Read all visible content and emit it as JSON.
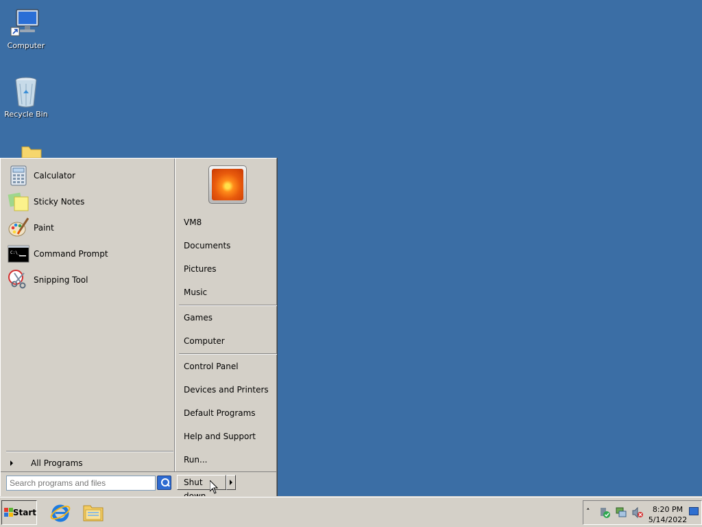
{
  "desktop": {
    "icons": [
      {
        "label": "Computer",
        "icon": "computer-icon"
      },
      {
        "label": "Recycle Bin",
        "icon": "recycle-bin-icon"
      },
      {
        "label": "",
        "icon": "folder-icon"
      }
    ]
  },
  "start_menu": {
    "programs": [
      {
        "label": "Calculator",
        "icon": "calculator-icon"
      },
      {
        "label": "Sticky Notes",
        "icon": "sticky-notes-icon"
      },
      {
        "label": "Paint",
        "icon": "paint-icon"
      },
      {
        "label": "Command Prompt",
        "icon": "command-prompt-icon"
      },
      {
        "label": "Snipping Tool",
        "icon": "snipping-tool-icon"
      }
    ],
    "all_programs": "All Programs",
    "search_placeholder": "Search programs and files",
    "right_items": [
      "VM8",
      "Documents",
      "Pictures",
      "Music",
      "Games",
      "Computer",
      "Control Panel",
      "Devices and Printers",
      "Default Programs",
      "Help and Support",
      "Run..."
    ],
    "shutdown_label": "Shut down"
  },
  "taskbar": {
    "start_label": "Start",
    "pinned": [
      {
        "icon": "internet-explorer-icon"
      },
      {
        "icon": "windows-explorer-icon"
      }
    ],
    "tray": {
      "icons": [
        "show-hidden-icons-icon",
        "action-center-icon",
        "network-icon",
        "volume-muted-icon"
      ],
      "time": "8:20 PM",
      "date": "5/14/2022"
    }
  },
  "colors": {
    "desktop_bg": "#3b6ea5",
    "menu_bg": "#d4d0c8"
  }
}
